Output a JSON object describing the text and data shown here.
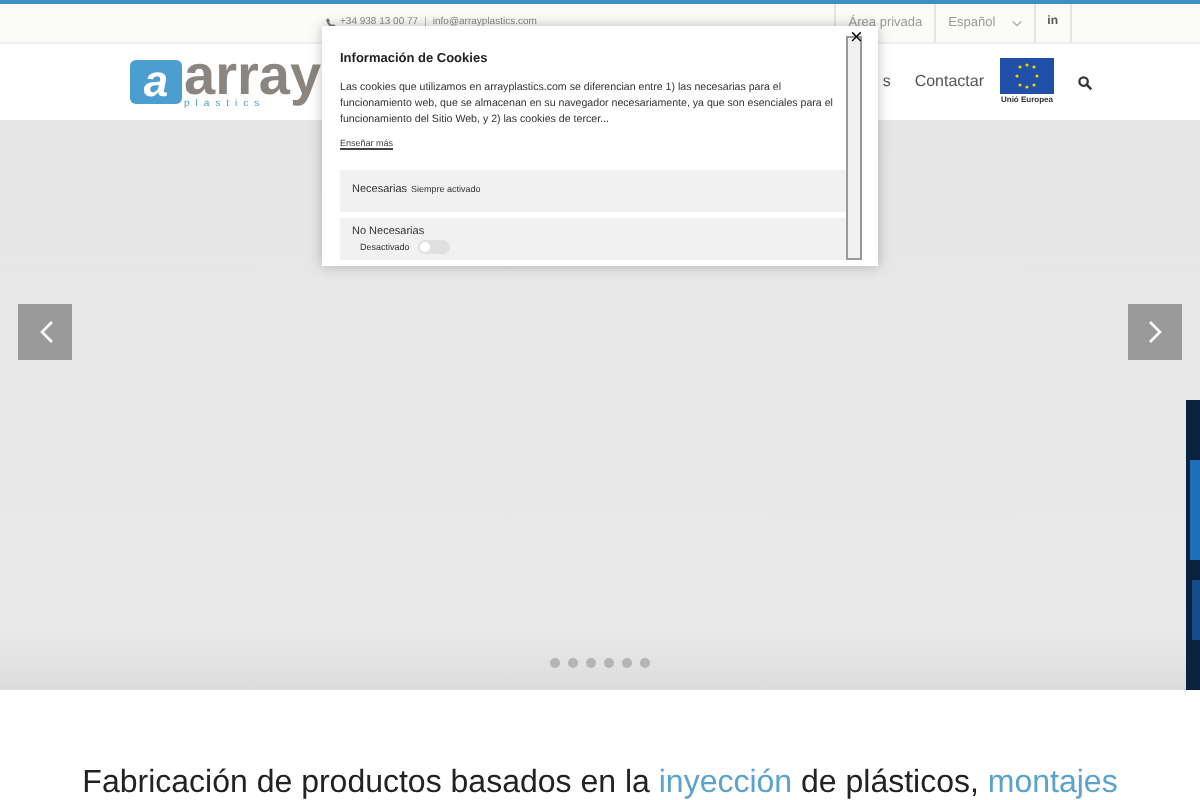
{
  "top_bar": {
    "phone": "+34 938 13 00 77",
    "separator": "|",
    "email": "info@arrayplastics.com",
    "links": [
      "Área privada",
      "Español",
      "in"
    ]
  },
  "logo": {
    "mark": "a",
    "name": "array",
    "tagline": "plastics"
  },
  "nav": {
    "items": [
      "s",
      "Contactar"
    ],
    "eu_caption": "Unió Europea"
  },
  "heading": [
    {
      "text": "Fabricación de productos basados en la ",
      "highlight": false
    },
    {
      "text": "inyección",
      "highlight": true
    },
    {
      "text": " de plásticos, ",
      "highlight": false
    },
    {
      "text": "montajes",
      "highlight": true
    }
  ],
  "cookie_dialog": {
    "title": "Información de Cookies",
    "body": "Las cookies que utilizamos en arrayplastics.com se diferencian entre 1) las necesarias para el funcionamiento web, que se almacenan en su navegador necesariamente, ya que son esenciales para el funcionamiento del Sitio Web, y 2) las cookies de tercer...",
    "more_link": "Enseñar más",
    "close": "×",
    "categories": [
      {
        "kind": "always",
        "name": "Necesarias",
        "status": "Siempre activado"
      },
      {
        "kind": "toggle",
        "name": "No Necesarias",
        "status": "Desactivado",
        "on": false
      }
    ]
  }
}
